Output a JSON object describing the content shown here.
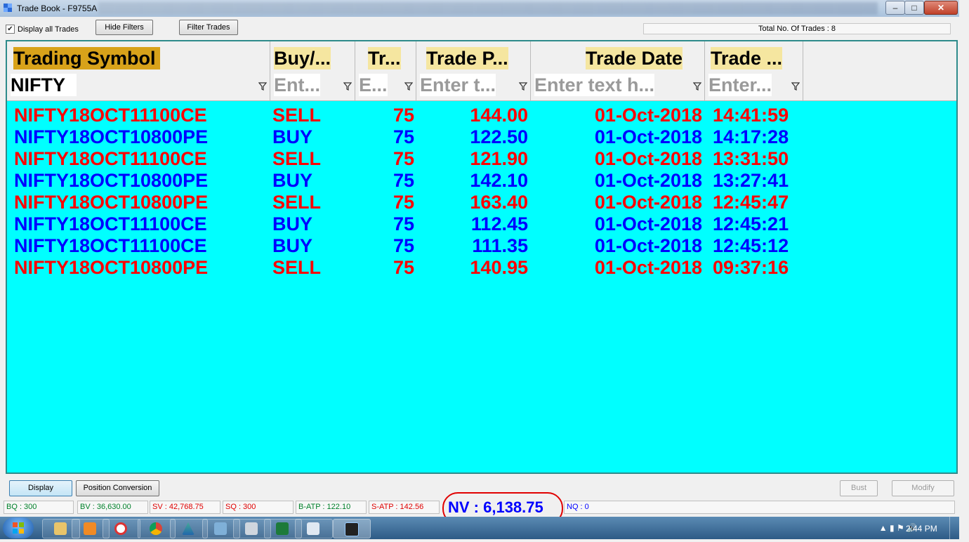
{
  "window": {
    "title": "Trade Book - F9755A",
    "minimize": "–",
    "maximize": "□",
    "close": "✕"
  },
  "toolbar": {
    "display_all_label": "Display all Trades",
    "display_all_checked": "✔",
    "hide_filters": "Hide Filters",
    "filter_trades": "Filter Trades",
    "total_trades": "Total No. Of Trades : 8"
  },
  "grid": {
    "columns": [
      "Trading Symbol",
      "Buy/...",
      "Tr...",
      "Trade P...",
      "Trade Date",
      "Trade ..."
    ],
    "filters": [
      "NIFTY",
      "Ent...",
      "E...",
      "Enter t...",
      "Enter text h...",
      "Enter..."
    ],
    "rows": [
      {
        "symbol": "NIFTY18OCT11100CE",
        "side": "SELL",
        "qty": "75",
        "price": "144.00",
        "date": "01-Oct-2018",
        "time": "14:41:59",
        "color": "red"
      },
      {
        "symbol": "NIFTY18OCT10800PE",
        "side": "BUY",
        "qty": "75",
        "price": "122.50",
        "date": "01-Oct-2018",
        "time": "14:17:28",
        "color": "blue"
      },
      {
        "symbol": "NIFTY18OCT11100CE",
        "side": "SELL",
        "qty": "75",
        "price": "121.90",
        "date": "01-Oct-2018",
        "time": "13:31:50",
        "color": "red"
      },
      {
        "symbol": "NIFTY18OCT10800PE",
        "side": "BUY",
        "qty": "75",
        "price": "142.10",
        "date": "01-Oct-2018",
        "time": "13:27:41",
        "color": "blue"
      },
      {
        "symbol": "NIFTY18OCT10800PE",
        "side": "SELL",
        "qty": "75",
        "price": "163.40",
        "date": "01-Oct-2018",
        "time": "12:45:47",
        "color": "red"
      },
      {
        "symbol": "NIFTY18OCT11100CE",
        "side": "BUY",
        "qty": "75",
        "price": "112.45",
        "date": "01-Oct-2018",
        "time": "12:45:21",
        "color": "blue"
      },
      {
        "symbol": "NIFTY18OCT11100CE",
        "side": "BUY",
        "qty": "75",
        "price": "111.35",
        "date": "01-Oct-2018",
        "time": "12:45:12",
        "color": "blue"
      },
      {
        "symbol": "NIFTY18OCT10800PE",
        "side": "SELL",
        "qty": "75",
        "price": "140.95",
        "date": "01-Oct-2018",
        "time": "09:37:16",
        "color": "red"
      }
    ],
    "colors": {
      "background": "#00ffff",
      "sell": "#ff0000",
      "buy": "#0000ff",
      "header_highlight": "#f5e6a0"
    }
  },
  "bottom": {
    "display": "Display",
    "position_conversion": "Position Conversion",
    "bust": "Bust",
    "modify": "Modify"
  },
  "status": {
    "bq": "BQ : 300",
    "bv": "BV : 36,630.00",
    "sv": "SV : 42,768.75",
    "sq": "SQ : 300",
    "batp": "B-ATP : 122.10",
    "satp": "S-ATP : 142.56",
    "nv": "NV : 6,138.75",
    "nq": "NQ : 0"
  },
  "taskbar": {
    "items": [
      "explorer-icon",
      "media-player-icon",
      "lifebuoy-icon",
      "chrome-icon",
      "delta-app-icon",
      "network-icon",
      "calculator-icon",
      "excel-icon",
      "window-icon",
      "trading-app-icon"
    ],
    "clock": "2:44 PM"
  }
}
